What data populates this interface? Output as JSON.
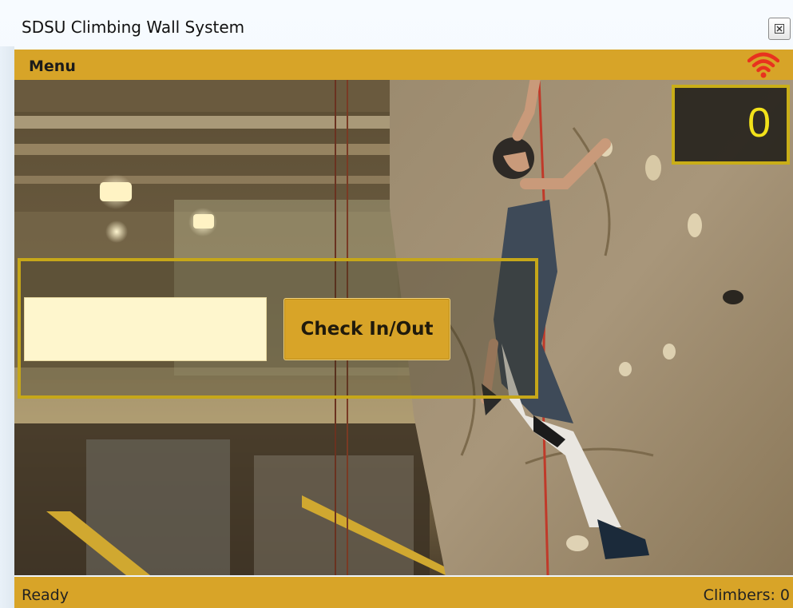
{
  "window": {
    "title": "SDSU Climbing Wall System"
  },
  "menubar": {
    "menu_label": "Menu",
    "signal_icon": "wifi-signal-icon",
    "signal_color": "#e8321e"
  },
  "counter": {
    "value": "0"
  },
  "checkin": {
    "id_value": "",
    "id_placeholder": "",
    "button_label": "Check In/Out"
  },
  "status": {
    "left": "Ready",
    "right": "Climbers: 0"
  },
  "colors": {
    "accent": "#d8a428",
    "panel_border": "#c6a719",
    "counter_text": "#f2e21a",
    "input_bg": "#fef6cd"
  }
}
